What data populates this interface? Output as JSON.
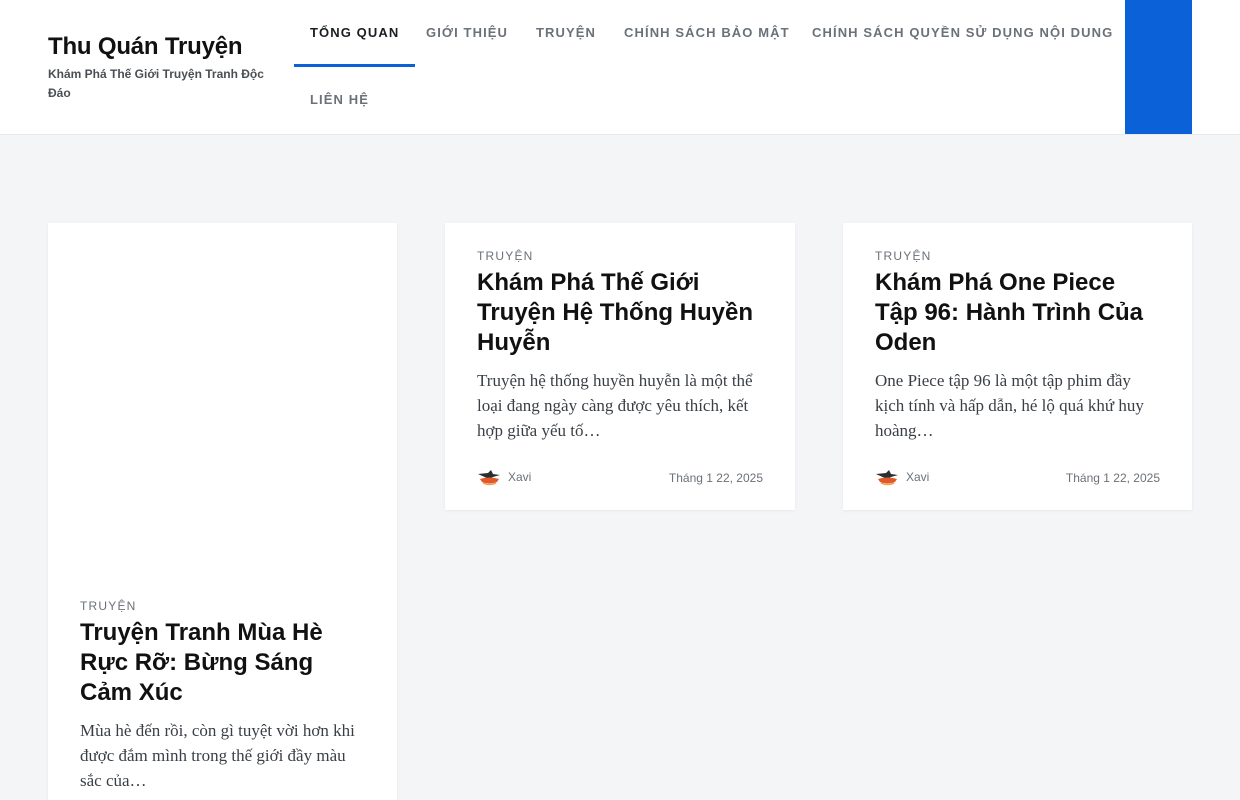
{
  "site": {
    "title": "Thu Quán Truyện",
    "tagline": "Khám Phá Thế Giới Truyện Tranh Độc Đáo"
  },
  "nav": {
    "items": [
      {
        "label": "TỔNG QUAN"
      },
      {
        "label": "GIỚI THIỆU"
      },
      {
        "label": "TRUYỆN"
      },
      {
        "label": "CHÍNH SÁCH BẢO MẬT"
      },
      {
        "label": "CHÍNH SÁCH QUYỀN SỬ DỤNG NỘI DUNG"
      },
      {
        "label": "LIÊN HỆ"
      }
    ],
    "active_index": 0
  },
  "colors": {
    "accent": "#0b61d8",
    "page_bg": "#f4f5f7"
  },
  "posts": [
    {
      "category": "TRUYỆN",
      "title": "Khám Phá Thế Giới Truyện Hệ Thống Huyền Huyễn",
      "excerpt": "Truyện hệ thống huyền huyễn là một thể loại đang ngày càng được yêu thích, kết hợp giữa yếu tố…",
      "author": "Xavi",
      "date": "Tháng 1 22, 2025"
    },
    {
      "category": "TRUYỆN",
      "title": "Khám Phá One Piece Tập 96: Hành Trình Của Oden",
      "excerpt": "One Piece tập 96 là một tập phim đầy kịch tính và hấp dẫn, hé lộ quá khứ huy hoàng…",
      "author": "Xavi",
      "date": "Tháng 1 22, 2025"
    },
    {
      "category": "TRUYỆN",
      "title": "Truyện Tranh Mùa Hè Rực Rỡ: Bừng Sáng Cảm Xúc",
      "excerpt": "Mùa hè đến rồi, còn gì tuyệt vời hơn khi được đắm mình trong thế giới đầy màu sắc của…"
    }
  ]
}
